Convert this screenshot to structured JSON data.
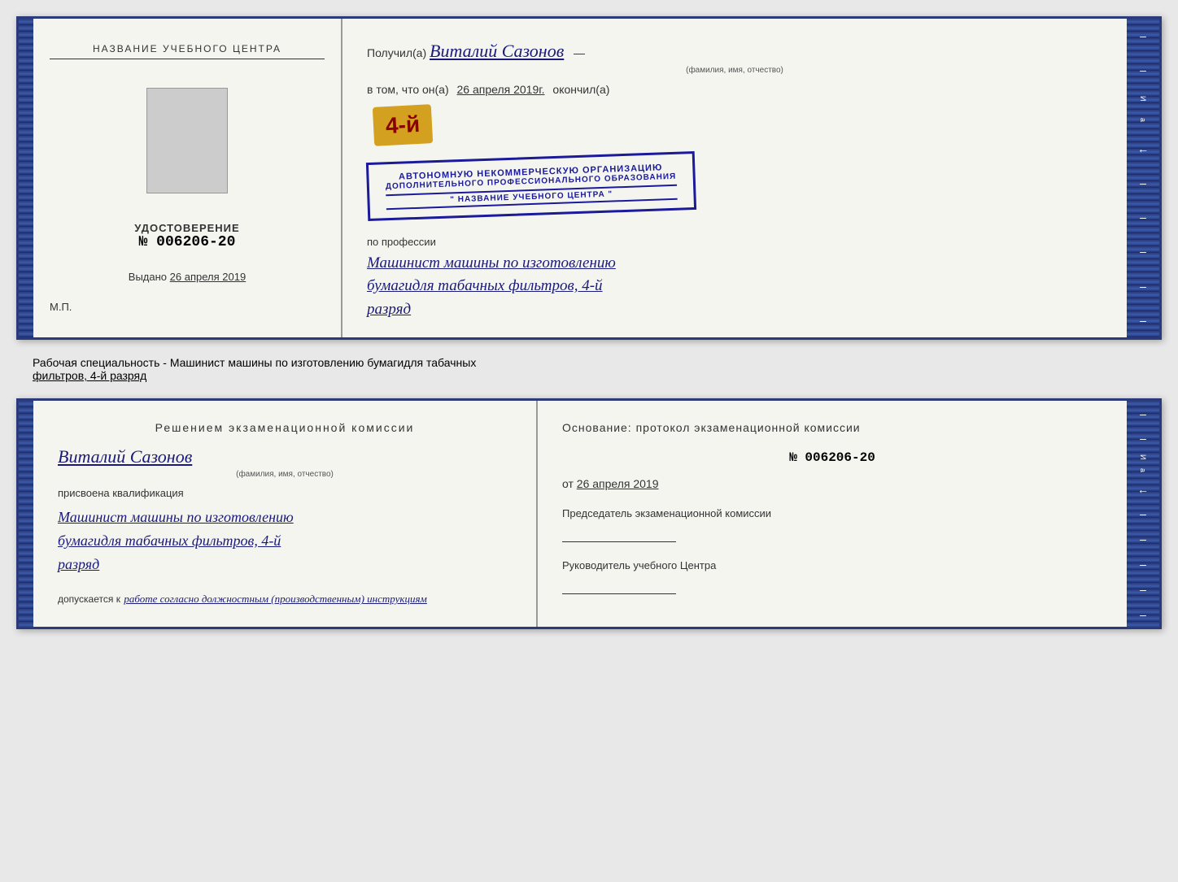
{
  "colors": {
    "navy": "#2a3a7a",
    "darkBlue": "#1a1a7a",
    "gold": "#d4a020",
    "darkRed": "#8B0000"
  },
  "certificate": {
    "left": {
      "training_center_label": "НАЗВАНИЕ УЧЕБНОГО ЦЕНТРА",
      "udost_label": "УДОСТОВЕРЕНИЕ",
      "number": "№ 006206-20",
      "issued_label": "Выдано",
      "issued_date": "26 апреля 2019",
      "mp_label": "М.П."
    },
    "right": {
      "recipient_prefix": "Получил(а)",
      "recipient_name": "Виталий Сазонов",
      "recipient_caption": "(фамилия, имя, отчество)",
      "certify_prefix": "в том, что он(а)",
      "certify_date": "26 апреля 2019г.",
      "certify_suffix": "окончил(а)",
      "year_badge": "4-й",
      "org_line1": "АВТОНОМНУЮ НЕКОММЕРЧЕСКУЮ ОРГАНИЗАЦИЮ",
      "org_line2": "ДОПОЛНИТЕЛЬНОГО ПРОФЕССИОНАЛЬНОГО ОБРАЗОВАНИЯ",
      "org_line3": "\" НАЗВАНИЕ УЧЕБНОГО ЦЕНТРА \"",
      "profession_label": "по профессии",
      "profession_line1": "Машинист машины по изготовлению",
      "profession_line2": "бумагидля табачных фильтров, 4-й",
      "profession_line3": "разряд"
    }
  },
  "work_specialty_bar": {
    "text_prefix": "Рабочая специальность - Машинист машины по изготовлению бумагидля табачных",
    "text_underline": "фильтров, 4-й разряд"
  },
  "bottom_left": {
    "decision_title": "Решением  экзаменационной  комиссии",
    "person_name": "Виталий Сазонов",
    "person_caption": "(фамилия, имя, отчество)",
    "assigned_label": "присвоена квалификация",
    "qual_line1": "Машинист машины по изготовлению",
    "qual_line2": "бумагидля табачных фильтров, 4-й",
    "qual_line3": "разряд",
    "admitted_label": "допускается к",
    "admitted_value": "работе согласно должностным (производственным) инструкциям"
  },
  "bottom_right": {
    "basis_label": "Основание: протокол экзаменационной  комиссии",
    "protocol_number": "№  006206-20",
    "protocol_date_prefix": "от",
    "protocol_date": "26 апреля 2019",
    "chairman_label": "Председатель экзаменационной комиссии",
    "director_label": "Руководитель учебного Центра"
  },
  "edge_items": [
    "И",
    "а",
    "←",
    "–",
    "–",
    "–",
    "–",
    "–"
  ]
}
